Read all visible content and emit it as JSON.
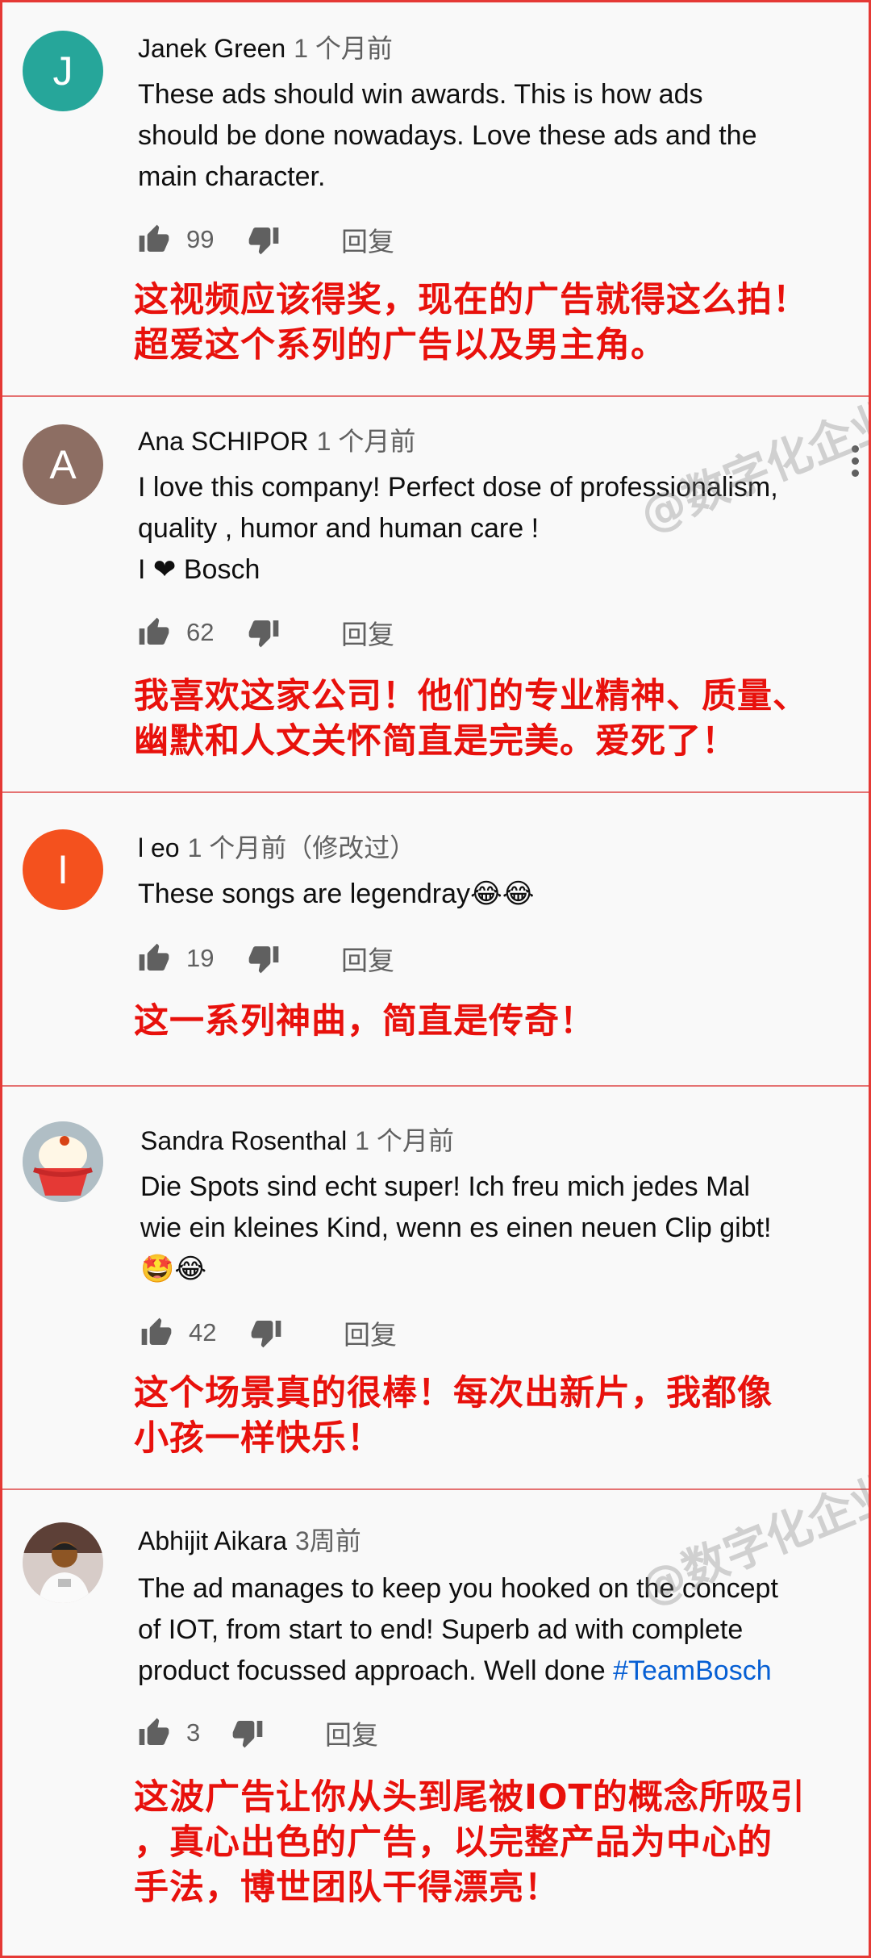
{
  "comments": [
    {
      "avatar_letter": "J",
      "avatar_color": "#26a69a",
      "author": "Janek Green",
      "time": "1 个月前",
      "body": [
        "These ads should win awards. This is how ads",
        "should be done nowadays. Love these ads and the",
        "main character."
      ],
      "likes": "99",
      "reply": "回复",
      "translation": [
        "这视频应该得奖，现在的广告就得这么拍！",
        "超爱这个系列的广告以及男主角。"
      ]
    },
    {
      "avatar_letter": "A",
      "avatar_color": "#8d6e63",
      "author": "Ana SCHIPOR",
      "time": "1 个月前",
      "body": [
        "I love this company! Perfect dose of professionalism,",
        "quality , humor and human care !"
      ],
      "body_heart_prefix": " I",
      "body_heart_suffix": " Bosch",
      "likes": "62",
      "reply": "回复",
      "translation": [
        "我喜欢这家公司！他们的专业精神、质量、",
        "幽默和人文关怀简直是完美。爱死了！"
      ]
    },
    {
      "avatar_letter": "I",
      "avatar_color": "#f4511e",
      "author": "l eo",
      "time": "1 个月前（修改过）",
      "body": [
        "These songs are legendray"
      ],
      "emoji": "😂😂",
      "likes": "19",
      "reply": "回复",
      "translation": [
        "这一系列神曲，简直是传奇！"
      ]
    },
    {
      "author": "Sandra Rosenthal",
      "time": "1 个月前",
      "body": [
        "Die Spots sind echt super! Ich freu mich jedes Mal",
        "wie ein kleines Kind, wenn es einen neuen Clip gibt!"
      ],
      "emoji": "🤩😂",
      "likes": "42",
      "reply": "回复",
      "translation": [
        "这个场景真的很棒！每次出新片，我都像",
        "小孩一样快乐！"
      ]
    },
    {
      "author": "Abhijit Aikara",
      "time": "3周前",
      "body": [
        "The ad manages to keep you hooked on the concept",
        "of IOT, from start to end! Superb ad with complete",
        "product focussed approach. Well done "
      ],
      "hashtag": "#TeamBosch",
      "likes": "3",
      "reply": "回复",
      "translation": [
        "这波广告让你从头到尾被IOT的概念所吸引",
        "，真心出色的广告，以完整产品为中心的",
        "手法，博世团队干得漂亮！"
      ]
    }
  ],
  "watermark": "@数字化企业",
  "colors": {
    "accent": "#e8110c",
    "hashtag": "#065fd4",
    "secondary_text": "#606060"
  }
}
